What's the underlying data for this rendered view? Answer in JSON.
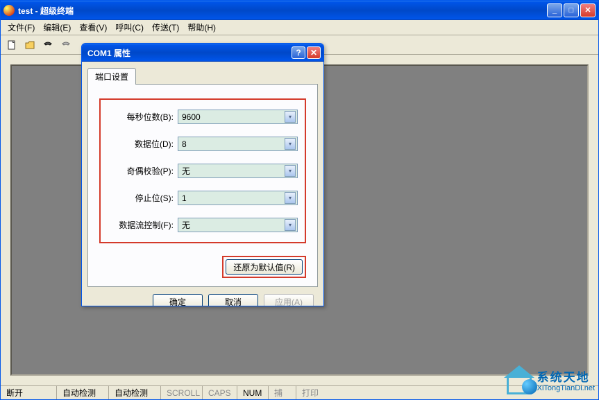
{
  "main_window": {
    "title": "test - 超级终端"
  },
  "menu": {
    "file": "文件(F)",
    "edit": "编辑(E)",
    "view": "查看(V)",
    "call": "呼叫(C)",
    "transfer": "传送(T)",
    "help": "帮助(H)"
  },
  "statusbar": {
    "disconnect": "断开",
    "autodetect1": "自动检测",
    "autodetect2": "自动检测",
    "scroll": "SCROLL",
    "caps": "CAPS",
    "num": "NUM",
    "capture": "捕",
    "print": "打印"
  },
  "dialog": {
    "title": "COM1 属性",
    "tab": "端口设置",
    "fields": {
      "baud": {
        "label": "每秒位数(B):",
        "value": "9600"
      },
      "databits": {
        "label": "数据位(D):",
        "value": "8"
      },
      "parity": {
        "label": "奇偶校验(P):",
        "value": "无"
      },
      "stopbits": {
        "label": "停止位(S):",
        "value": "1"
      },
      "flowctrl": {
        "label": "数据流控制(F):",
        "value": "无"
      }
    },
    "restore_defaults": "还原为默认值(R)",
    "ok": "确定",
    "cancel": "取消",
    "apply": "应用(A)"
  },
  "watermark": {
    "line1": "系统天地",
    "line2": "XiTongTianDi.net"
  }
}
